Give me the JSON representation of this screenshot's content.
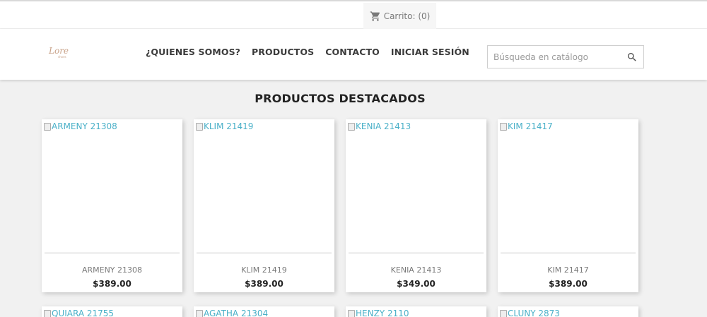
{
  "cart": {
    "label": "Carrito: (0)",
    "icon": "cart-icon"
  },
  "logo": {
    "icon": "brand-logo"
  },
  "nav": [
    {
      "label": "¿QUIENES SOMOS?"
    },
    {
      "label": "PRODUCTOS"
    },
    {
      "label": "CONTACTO"
    },
    {
      "label": "INICIAR SESIÓN"
    }
  ],
  "search": {
    "placeholder": "Búsqueda en catálogo",
    "icon": "search-icon"
  },
  "featured": {
    "title": "PRODUCTOS DESTACADOS",
    "products": [
      {
        "name": "ARMENY 21308",
        "alt": "ARMENY 21308",
        "price": "$389.00"
      },
      {
        "name": "KLIM 21419",
        "alt": "KLIM 21419",
        "price": "$389.00"
      },
      {
        "name": "KENIA 21413",
        "alt": "KENIA 21413",
        "price": "$349.00"
      },
      {
        "name": "KIM 21417",
        "alt": "KIM 21417",
        "price": "$389.00"
      }
    ],
    "products_row2": [
      {
        "alt": "QUIARA 21755"
      },
      {
        "alt": "AGATHA 21304"
      },
      {
        "alt": "HENZY 2110"
      },
      {
        "alt": "CLUNY 2873"
      }
    ]
  },
  "colors": {
    "link": "#4ab0c8",
    "accent": "#232323"
  }
}
